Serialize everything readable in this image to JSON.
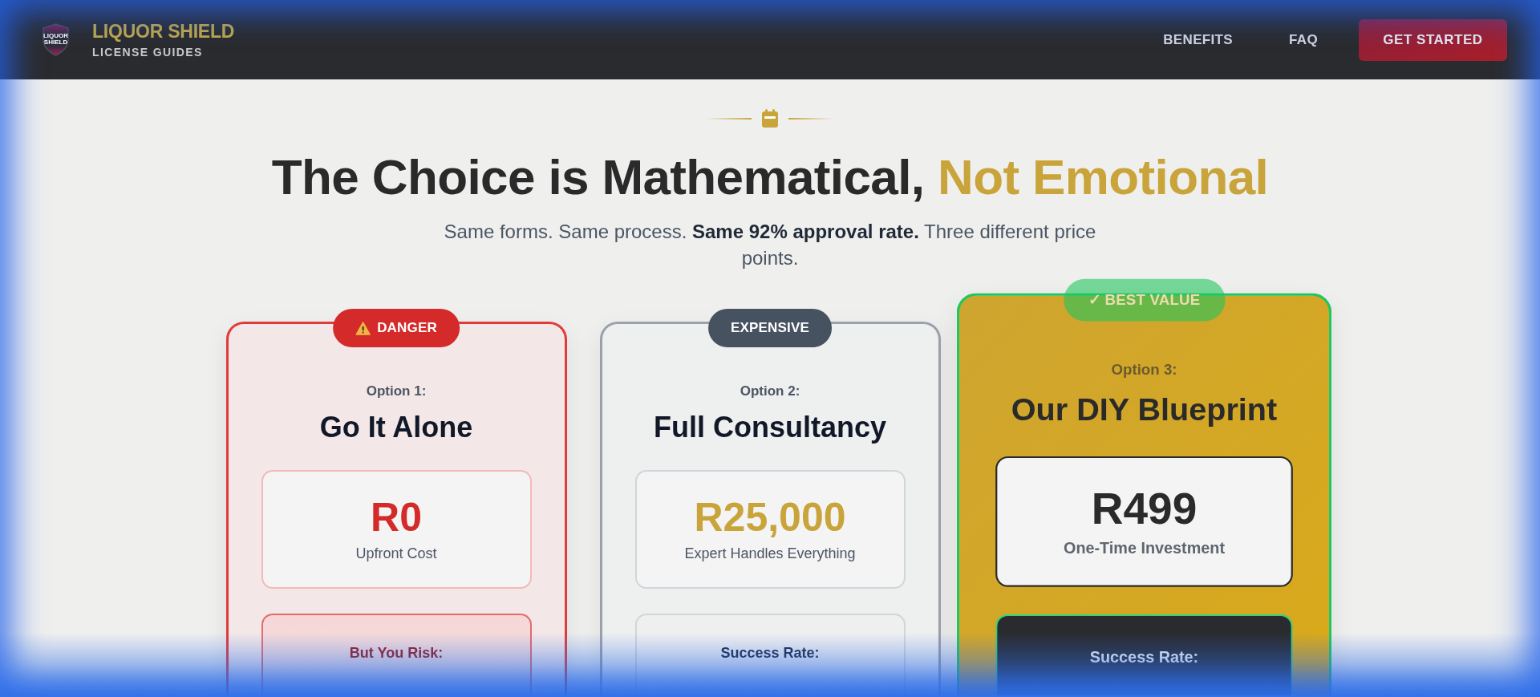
{
  "header": {
    "logo_text": "LIQUOR SHIELD",
    "brand_name": "LIQUOR SHIELD",
    "brand_tagline": "LICENSE GUIDES",
    "nav_links": [
      {
        "label": "BENEFITS"
      },
      {
        "label": "FAQ"
      }
    ],
    "cta_button": "GET STARTED"
  },
  "hero": {
    "title": "The Choice is Mathematical,",
    "title_highlight": "Not Emotional",
    "subtitle": "Same forms. Same process. **Same 92% approval rate.** Three different price points."
  },
  "options": [
    {
      "kind": "danger",
      "badge": "DANGER",
      "option_label": "Option 1:",
      "title": "Go It Alone",
      "price": "R0",
      "price_caption": "Upfront Cost",
      "stat_label": "But You Risk:"
    },
    {
      "kind": "expensive",
      "badge": "EXPENSIVE",
      "option_label": "Option 2:",
      "title": "Full Consultancy",
      "price": "R25,000",
      "price_caption": "Expert Handles Everything",
      "stat_label": "Success Rate:"
    },
    {
      "kind": "recommended",
      "badge": "✓ BEST VALUE",
      "option_label": "Option 3:",
      "title": "Our DIY Blueprint",
      "price": "R499",
      "price_caption": "One-Time Investment",
      "stat_label": "Success Rate:"
    }
  ]
}
